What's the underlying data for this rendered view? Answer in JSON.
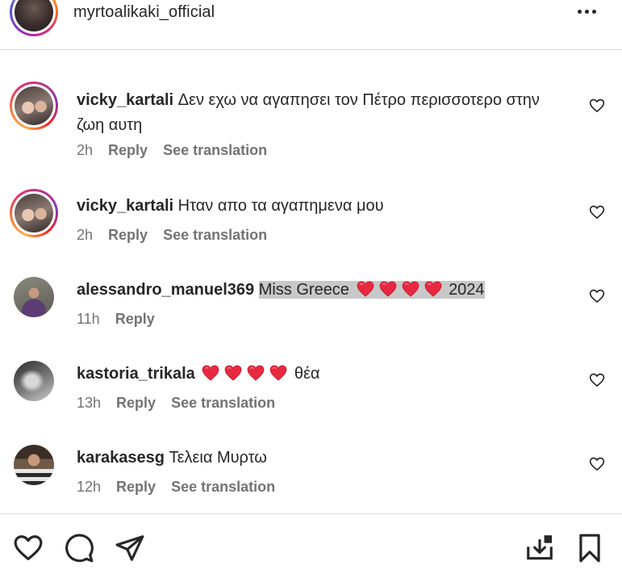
{
  "header": {
    "username": "myrtoalikaki_official"
  },
  "comments": [
    {
      "username": "vicky_kartali",
      "text": "Δεν εχω να αγαπησει τον Πέτρο περισσοτερο στην ζωη αυτη",
      "time": "2h",
      "reply": "Reply",
      "translate": "See translation"
    },
    {
      "username": "vicky_kartali",
      "text": "Ηταν απο τα αγαπημενα μου",
      "time": "2h",
      "reply": "Reply",
      "translate": "See translation"
    },
    {
      "username": "alessandro_manuel369",
      "text_before": "Miss Greece",
      "text_after": "2024",
      "emoji": "❤️❤️❤️❤️",
      "time": "11h",
      "reply": "Reply"
    },
    {
      "username": "kastoria_trikala",
      "emoji": "❤️❤️❤️❤️",
      "text_after": "θέα",
      "time": "13h",
      "reply": "Reply",
      "translate": "See translation"
    },
    {
      "username": "karakasesg",
      "text": "Τελεια Μυρτω",
      "time": "12h",
      "reply": "Reply",
      "translate": "See translation"
    }
  ],
  "icons": {
    "like": "heart-icon",
    "comment": "comment-icon",
    "share": "send-icon",
    "save_to_collection": "download-icon",
    "bookmark": "bookmark-icon",
    "more": "more-icon"
  },
  "colors": {
    "text": "#262626",
    "secondary": "#737373",
    "border": "#dbdbdb",
    "heart_red": "#e8283f",
    "highlight": "#c8c8c8"
  }
}
